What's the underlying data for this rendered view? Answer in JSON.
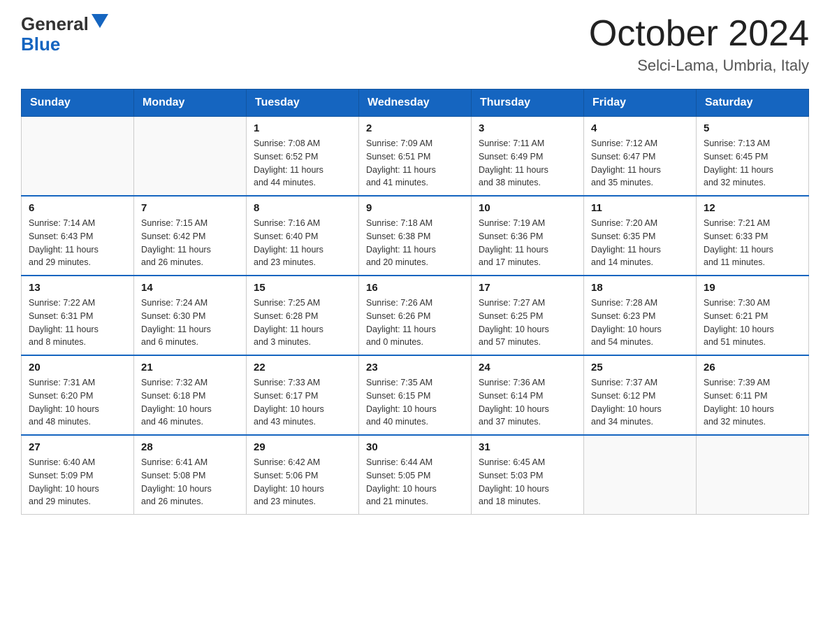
{
  "header": {
    "logo_general": "General",
    "logo_blue": "Blue",
    "month": "October 2024",
    "location": "Selci-Lama, Umbria, Italy"
  },
  "days_of_week": [
    "Sunday",
    "Monday",
    "Tuesday",
    "Wednesday",
    "Thursday",
    "Friday",
    "Saturday"
  ],
  "weeks": [
    [
      {
        "day": "",
        "info": ""
      },
      {
        "day": "",
        "info": ""
      },
      {
        "day": "1",
        "info": "Sunrise: 7:08 AM\nSunset: 6:52 PM\nDaylight: 11 hours\nand 44 minutes."
      },
      {
        "day": "2",
        "info": "Sunrise: 7:09 AM\nSunset: 6:51 PM\nDaylight: 11 hours\nand 41 minutes."
      },
      {
        "day": "3",
        "info": "Sunrise: 7:11 AM\nSunset: 6:49 PM\nDaylight: 11 hours\nand 38 minutes."
      },
      {
        "day": "4",
        "info": "Sunrise: 7:12 AM\nSunset: 6:47 PM\nDaylight: 11 hours\nand 35 minutes."
      },
      {
        "day": "5",
        "info": "Sunrise: 7:13 AM\nSunset: 6:45 PM\nDaylight: 11 hours\nand 32 minutes."
      }
    ],
    [
      {
        "day": "6",
        "info": "Sunrise: 7:14 AM\nSunset: 6:43 PM\nDaylight: 11 hours\nand 29 minutes."
      },
      {
        "day": "7",
        "info": "Sunrise: 7:15 AM\nSunset: 6:42 PM\nDaylight: 11 hours\nand 26 minutes."
      },
      {
        "day": "8",
        "info": "Sunrise: 7:16 AM\nSunset: 6:40 PM\nDaylight: 11 hours\nand 23 minutes."
      },
      {
        "day": "9",
        "info": "Sunrise: 7:18 AM\nSunset: 6:38 PM\nDaylight: 11 hours\nand 20 minutes."
      },
      {
        "day": "10",
        "info": "Sunrise: 7:19 AM\nSunset: 6:36 PM\nDaylight: 11 hours\nand 17 minutes."
      },
      {
        "day": "11",
        "info": "Sunrise: 7:20 AM\nSunset: 6:35 PM\nDaylight: 11 hours\nand 14 minutes."
      },
      {
        "day": "12",
        "info": "Sunrise: 7:21 AM\nSunset: 6:33 PM\nDaylight: 11 hours\nand 11 minutes."
      }
    ],
    [
      {
        "day": "13",
        "info": "Sunrise: 7:22 AM\nSunset: 6:31 PM\nDaylight: 11 hours\nand 8 minutes."
      },
      {
        "day": "14",
        "info": "Sunrise: 7:24 AM\nSunset: 6:30 PM\nDaylight: 11 hours\nand 6 minutes."
      },
      {
        "day": "15",
        "info": "Sunrise: 7:25 AM\nSunset: 6:28 PM\nDaylight: 11 hours\nand 3 minutes."
      },
      {
        "day": "16",
        "info": "Sunrise: 7:26 AM\nSunset: 6:26 PM\nDaylight: 11 hours\nand 0 minutes."
      },
      {
        "day": "17",
        "info": "Sunrise: 7:27 AM\nSunset: 6:25 PM\nDaylight: 10 hours\nand 57 minutes."
      },
      {
        "day": "18",
        "info": "Sunrise: 7:28 AM\nSunset: 6:23 PM\nDaylight: 10 hours\nand 54 minutes."
      },
      {
        "day": "19",
        "info": "Sunrise: 7:30 AM\nSunset: 6:21 PM\nDaylight: 10 hours\nand 51 minutes."
      }
    ],
    [
      {
        "day": "20",
        "info": "Sunrise: 7:31 AM\nSunset: 6:20 PM\nDaylight: 10 hours\nand 48 minutes."
      },
      {
        "day": "21",
        "info": "Sunrise: 7:32 AM\nSunset: 6:18 PM\nDaylight: 10 hours\nand 46 minutes."
      },
      {
        "day": "22",
        "info": "Sunrise: 7:33 AM\nSunset: 6:17 PM\nDaylight: 10 hours\nand 43 minutes."
      },
      {
        "day": "23",
        "info": "Sunrise: 7:35 AM\nSunset: 6:15 PM\nDaylight: 10 hours\nand 40 minutes."
      },
      {
        "day": "24",
        "info": "Sunrise: 7:36 AM\nSunset: 6:14 PM\nDaylight: 10 hours\nand 37 minutes."
      },
      {
        "day": "25",
        "info": "Sunrise: 7:37 AM\nSunset: 6:12 PM\nDaylight: 10 hours\nand 34 minutes."
      },
      {
        "day": "26",
        "info": "Sunrise: 7:39 AM\nSunset: 6:11 PM\nDaylight: 10 hours\nand 32 minutes."
      }
    ],
    [
      {
        "day": "27",
        "info": "Sunrise: 6:40 AM\nSunset: 5:09 PM\nDaylight: 10 hours\nand 29 minutes."
      },
      {
        "day": "28",
        "info": "Sunrise: 6:41 AM\nSunset: 5:08 PM\nDaylight: 10 hours\nand 26 minutes."
      },
      {
        "day": "29",
        "info": "Sunrise: 6:42 AM\nSunset: 5:06 PM\nDaylight: 10 hours\nand 23 minutes."
      },
      {
        "day": "30",
        "info": "Sunrise: 6:44 AM\nSunset: 5:05 PM\nDaylight: 10 hours\nand 21 minutes."
      },
      {
        "day": "31",
        "info": "Sunrise: 6:45 AM\nSunset: 5:03 PM\nDaylight: 10 hours\nand 18 minutes."
      },
      {
        "day": "",
        "info": ""
      },
      {
        "day": "",
        "info": ""
      }
    ]
  ]
}
